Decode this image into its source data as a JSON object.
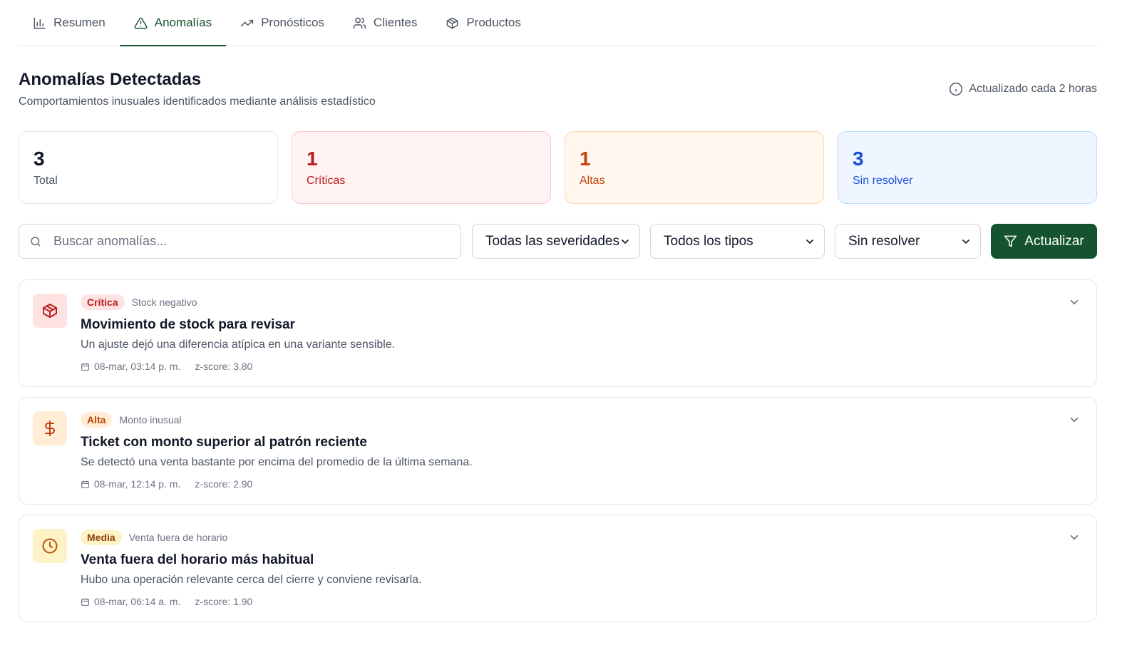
{
  "tabs": [
    {
      "label": "Resumen",
      "icon": "bar-chart-icon"
    },
    {
      "label": "Anomalías",
      "icon": "warning-triangle-icon",
      "active": true
    },
    {
      "label": "Pronósticos",
      "icon": "trending-up-icon"
    },
    {
      "label": "Clientes",
      "icon": "users-icon"
    },
    {
      "label": "Productos",
      "icon": "package-icon"
    }
  ],
  "header": {
    "title": "Anomalías Detectadas",
    "subtitle": "Comportamientos inusuales identificados mediante análisis estadístico",
    "update_note": "Actualizado cada 2 horas"
  },
  "stats": {
    "total": {
      "value": "3",
      "label": "Total"
    },
    "critical": {
      "value": "1",
      "label": "Críticas"
    },
    "high": {
      "value": "1",
      "label": "Altas"
    },
    "unresolved": {
      "value": "3",
      "label": "Sin resolver"
    }
  },
  "filters": {
    "search_placeholder": "Buscar anomalías...",
    "severity": "Todas las severidades",
    "type": "Todos los tipos",
    "status": "Sin resolver",
    "refresh_label": "Actualizar"
  },
  "anomalies": [
    {
      "severity": "Crítica",
      "category": "Stock negativo",
      "title": "Movimiento de stock para revisar",
      "description": "Un ajuste dejó una diferencia atípica en una variante sensible.",
      "date": "08-mar, 03:14 p. m.",
      "zscore": "z-score: 3.80",
      "icon": "package-icon",
      "color": "#b91c1c"
    },
    {
      "severity": "Alta",
      "category": "Monto inusual",
      "title": "Ticket con monto superior al patrón reciente",
      "description": "Se detectó una venta bastante por encima del promedio de la última semana.",
      "date": "08-mar, 12:14 p. m.",
      "zscore": "z-score: 2.90",
      "icon": "dollar-icon",
      "color": "#c2410c"
    },
    {
      "severity": "Media",
      "category": "Venta fuera de horario",
      "title": "Venta fuera del horario más habitual",
      "description": "Hubo una operación relevante cerca del cierre y conviene revisarla.",
      "date": "08-mar, 06:14 a. m.",
      "zscore": "z-score: 1.90",
      "icon": "clock-icon",
      "color": "#b45309"
    }
  ],
  "colors": {
    "brand": "#14532d",
    "critical": "#b91c1c",
    "high": "#c2410c",
    "medium": "#b45309",
    "info": "#1d4ed8"
  }
}
